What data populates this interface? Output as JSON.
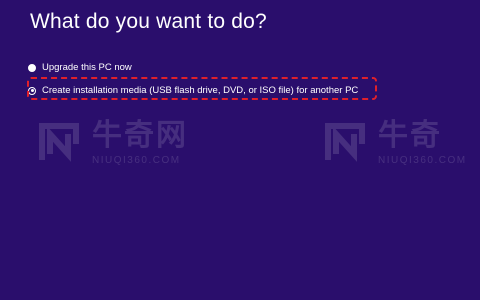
{
  "dialog": {
    "heading": "What do you want to do?",
    "options": [
      {
        "label": "Upgrade this PC now"
      },
      {
        "label": "Create installation media (USB flash drive, DVD, or ISO file) for another PC"
      }
    ]
  },
  "watermark": {
    "brand_cn": "牛奇网",
    "brand_cn_short": "牛奇",
    "url": "NIUQI360.COM"
  },
  "colors": {
    "background": "#2a0e6c",
    "highlight_border": "#e0202a",
    "text": "#ffffff"
  }
}
